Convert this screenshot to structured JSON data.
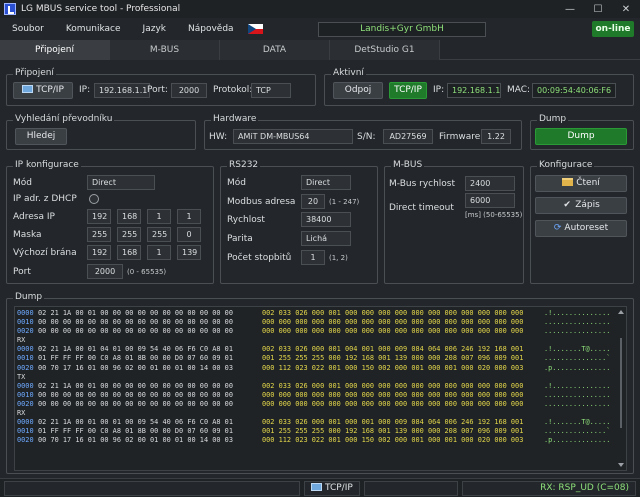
{
  "window": {
    "title": "LG MBUS service tool - Professional",
    "minimize": "—",
    "maximize": "☐",
    "close": "✕"
  },
  "menu": {
    "items": [
      "Soubor",
      "Komunikace",
      "Jazyk",
      "Nápověda"
    ]
  },
  "company": "Landis+Gyr GmbH",
  "status_online": "on-line",
  "tabs": [
    {
      "label": "Připojení",
      "active": true
    },
    {
      "label": "M-BUS",
      "active": false
    },
    {
      "label": "DATA",
      "active": false
    },
    {
      "label": "DetStudio G1",
      "active": false
    }
  ],
  "connection": {
    "title": "Připojení",
    "mode_button": "TCP/IP",
    "ip_label": "IP:",
    "ip_value": "192.168.1.1",
    "port_label": "Port:",
    "port_value": "2000",
    "protocol_label": "Protokol:",
    "protocol_value": "TCP"
  },
  "active": {
    "title": "Aktivní",
    "disconnect_button": "Odpoj",
    "mode_button": "TCP/IP",
    "ip_label": "IP:",
    "ip_value": "192.168.1.1",
    "mac_label": "MAC:",
    "mac_value": "00:09:54:40:06:F6"
  },
  "search": {
    "title": "Vyhledání převodníku",
    "button": "Hledej"
  },
  "hardware": {
    "title": "Hardware",
    "hw_label": "HW:",
    "hw_value": "AMiT DM-MBUS64",
    "sn_label": "S/N:",
    "sn_value": "AD27569",
    "fw_label": "Firmware:",
    "fw_value": "1.22"
  },
  "dump_group": {
    "title": "Dump",
    "button": "Dump"
  },
  "ip_config": {
    "title": "IP konfigurace",
    "mode_label": "Mód",
    "mode_value": "Direct",
    "dhcp_label": "IP adr. z DHCP",
    "address_label": "Adresa IP",
    "address": [
      "192",
      "168",
      "1",
      "1"
    ],
    "mask_label": "Maska",
    "mask": [
      "255",
      "255",
      "255",
      "0"
    ],
    "gateway_label": "Výchozí brána",
    "gateway": [
      "192",
      "168",
      "1",
      "139"
    ],
    "port_label": "Port",
    "port_value": "2000",
    "port_range": "(0 - 65535)"
  },
  "rs232": {
    "title": "RS232",
    "mode_label": "Mód",
    "mode_value": "Direct",
    "modbus_label": "Modbus adresa",
    "modbus_value": "20",
    "modbus_range": "(1 - 247)",
    "speed_label": "Rychlost",
    "speed_value": "38400",
    "parity_label": "Parita",
    "parity_value": "Lichá",
    "stopbits_label": "Počet stopbitů",
    "stopbits_value": "1",
    "stopbits_range": "(1, 2)"
  },
  "mbus": {
    "title": "M-BUS",
    "speed_label": "M-Bus rychlost",
    "speed_value": "2400",
    "timeout_label": "Direct timeout",
    "timeout_value": "6000",
    "timeout_range": "[ms] (50-65535)"
  },
  "config": {
    "title": "Konfigurace",
    "read_button": "Čtení",
    "write_button": "Zápis",
    "autoreset_button": "Autoreset"
  },
  "dump": {
    "title": "Dump",
    "lines": [
      {
        "addr": "0000",
        "hex": "02 21 1A 00 01 00 00 00 00 00 00 00 00 00 00 00",
        "dec": "002 033 026 000 001 000 000 000 000 000 000 000 000 000 000 000",
        "asc": ".!.............."
      },
      {
        "addr": "0010",
        "hex": "00 00 00 00 00 00 00 00 00 00 00 00 00 00 00 00",
        "dec": "000 000 000 000 000 000 000 000 000 000 000 000 000 000 000 000",
        "asc": "................"
      },
      {
        "addr": "0020",
        "hex": "00 00 00 00 00 00 00 00 00 00 00 00 00 00 00 00",
        "dec": "000 000 000 000 000 000 000 000 000 000 000 000 000 000 000 000",
        "asc": "................"
      },
      {
        "dir": "RX"
      },
      {
        "addr": "0000",
        "hex": "02 21 1A 00 01 04 01 00 09 54 40 06 F6 C0 A8 01",
        "dec": "002 033 026 000 001 004 001 000 009 084 064 006 246 192 168 001",
        "asc": ".!.......T@....."
      },
      {
        "addr": "0010",
        "hex": "01 FF FF FF 00 C0 A8 01 8B 00 00 D0 07 60 09 01",
        "dec": "001 255 255 255 000 192 168 001 139 000 000 208 007 096 009 001",
        "asc": "...............`"
      },
      {
        "addr": "0020",
        "hex": "00 70 17 16 01 00 96 02 00 01 00 01 00 14 00 03",
        "dec": "000 112 023 022 001 000 150 002 000 001 000 001 000 020 000 003",
        "asc": ".p.............."
      },
      {
        "dir": "TX"
      },
      {
        "addr": "0000",
        "hex": "02 21 1A 00 01 00 00 00 00 00 00 00 00 00 00 00",
        "dec": "002 033 026 000 001 000 000 000 000 000 000 000 000 000 000 000",
        "asc": ".!.............."
      },
      {
        "addr": "0010",
        "hex": "00 00 00 00 00 00 00 00 00 00 00 00 00 00 00 00",
        "dec": "000 000 000 000 000 000 000 000 000 000 000 000 000 000 000 000",
        "asc": "................"
      },
      {
        "addr": "0020",
        "hex": "00 00 00 00 00 00 00 00 00 00 00 00 00 00 00 00",
        "dec": "000 000 000 000 000 000 000 000 000 000 000 000 000 000 000 000",
        "asc": "................"
      },
      {
        "dir": "RX"
      },
      {
        "addr": "0000",
        "hex": "02 21 1A 00 01 00 01 00 09 54 40 06 F6 C0 A8 01",
        "dec": "002 033 026 000 001 000 001 000 009 084 064 006 246 192 168 001",
        "asc": ".!.......T@....."
      },
      {
        "addr": "0010",
        "hex": "01 FF FF FF 00 C0 A8 01 8B 00 00 D0 07 60 09 01",
        "dec": "001 255 255 255 000 192 168 001 139 000 000 208 007 096 009 001",
        "asc": "...............`"
      },
      {
        "addr": "0020",
        "hex": "00 70 17 16 01 00 96 02 00 01 00 01 00 14 00 03",
        "dec": "000 112 023 022 001 000 150 002 000 001 000 001 000 020 000 003",
        "asc": ".p.............."
      }
    ]
  },
  "statusbar": {
    "mode": "TCP/IP",
    "rx_status": "RX: RSP_UD (C=08)"
  },
  "colors": {
    "accent_green": "#1f7a2a",
    "text_green": "#8ee07a",
    "address_blue": "#6da9ff",
    "decimal_yellow": "#e2d64a"
  },
  "icons": {
    "connection": "monitor-icon",
    "read": "folder-icon",
    "write": "check-icon",
    "autoreset": "refresh-icon"
  }
}
